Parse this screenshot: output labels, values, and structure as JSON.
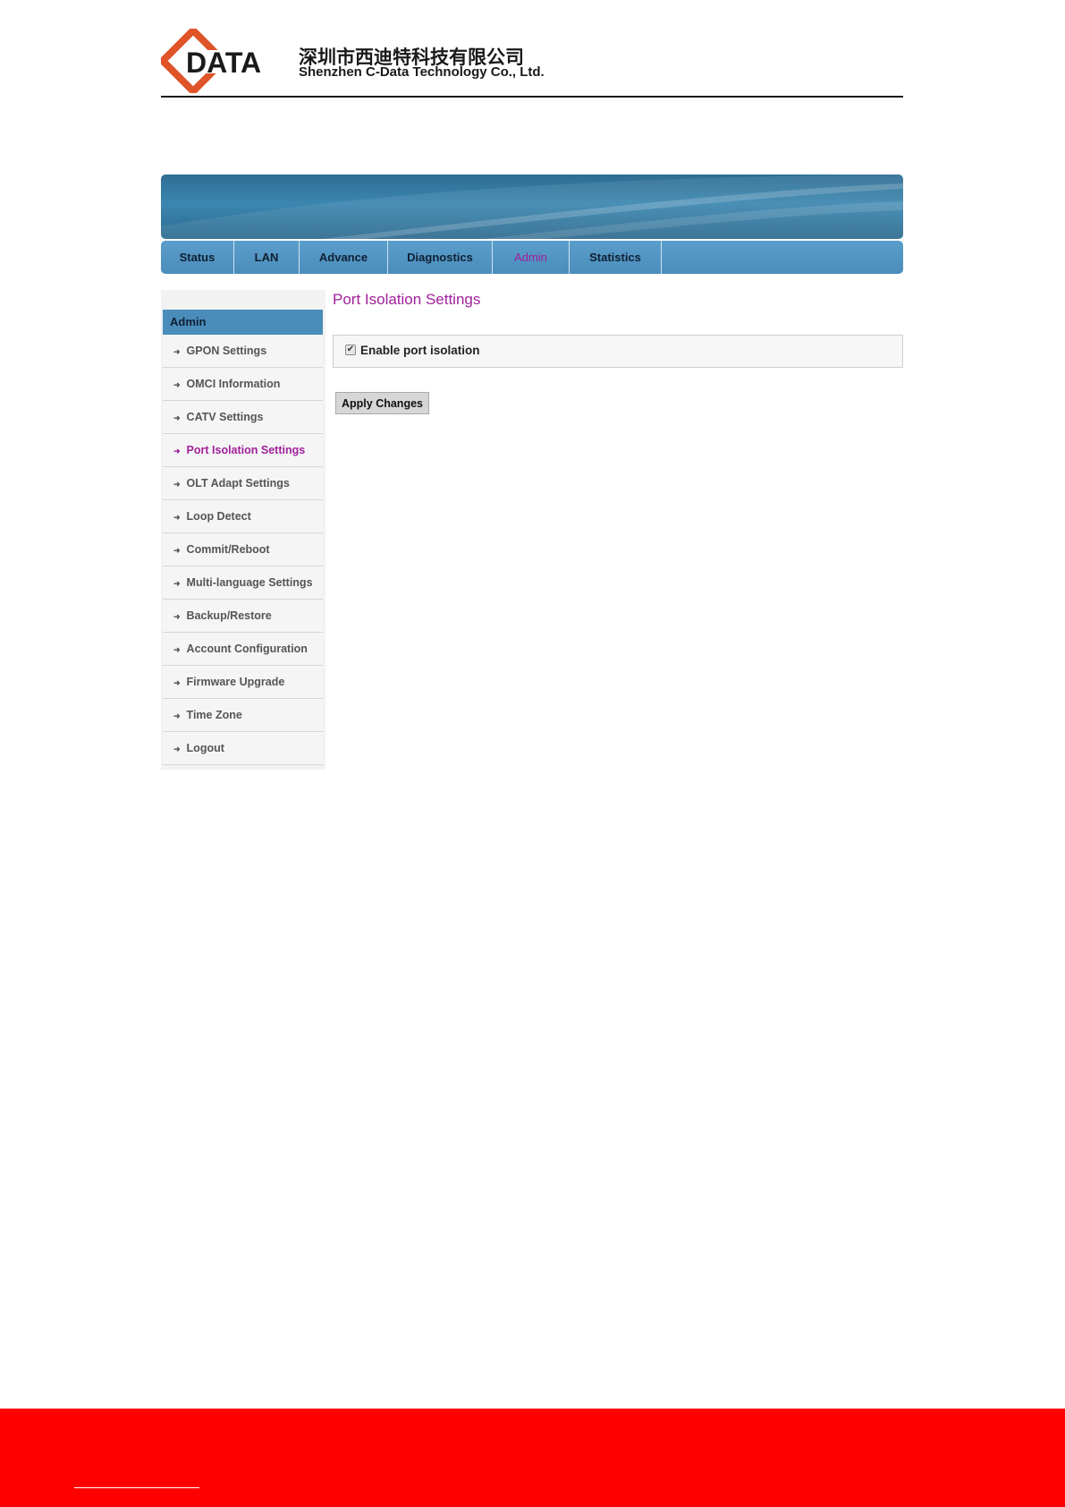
{
  "company": {
    "logo_text": "DATA",
    "name_cn": "深圳市西迪特科技有限公司",
    "name_en": "Shenzhen C-Data Technology Co., Ltd.",
    "brand_colors": {
      "orange": "#e0542a",
      "dark": "#1a1a1a"
    }
  },
  "nav": {
    "tabs": [
      {
        "label": "Status"
      },
      {
        "label": "LAN"
      },
      {
        "label": "Advance"
      },
      {
        "label": "Diagnostics"
      },
      {
        "label": "Admin",
        "active": true
      },
      {
        "label": "Statistics"
      }
    ],
    "active_color": "#a0209b"
  },
  "sidebar": {
    "header": "Admin",
    "items": [
      {
        "label": "GPON Settings"
      },
      {
        "label": "OMCI Information"
      },
      {
        "label": "CATV Settings"
      },
      {
        "label": "Port Isolation Settings",
        "active": true
      },
      {
        "label": "OLT Adapt Settings"
      },
      {
        "label": "Loop Detect"
      },
      {
        "label": "Commit/Reboot"
      },
      {
        "label": "Multi-language Settings"
      },
      {
        "label": "Backup/Restore"
      },
      {
        "label": "Account Configuration"
      },
      {
        "label": "Firmware Upgrade"
      },
      {
        "label": "Time Zone"
      },
      {
        "label": "Logout"
      }
    ]
  },
  "main": {
    "title": "Port Isolation Settings",
    "enable_label": "Enable port isolation",
    "enable_checked": true,
    "apply_label": "Apply Changes"
  },
  "footer": {
    "band_color": "#ff0000"
  }
}
